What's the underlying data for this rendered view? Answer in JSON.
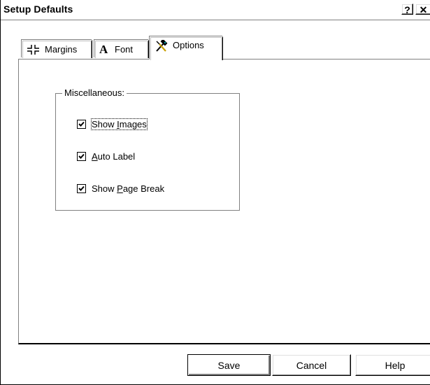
{
  "window": {
    "title": "Setup Defaults",
    "help_button": "?",
    "close_button": "✕"
  },
  "tabs": [
    {
      "label": "Margins",
      "icon": "margins-icon",
      "selected": false
    },
    {
      "label": "Font",
      "icon": "font-icon",
      "selected": false
    },
    {
      "label": "Options",
      "icon": "tools-icon",
      "selected": true
    }
  ],
  "miscellaneous": {
    "legend": "Miscellaneous:",
    "options": [
      {
        "pre": "Show ",
        "key": "I",
        "post": "mages",
        "checked": true
      },
      {
        "pre": "",
        "key": "A",
        "post": "uto Label",
        "checked": true
      },
      {
        "pre": "Show ",
        "key": "P",
        "post": "age Break",
        "checked": true
      }
    ]
  },
  "buttons": {
    "save": "Save",
    "cancel": "Cancel",
    "help": "Help"
  },
  "colors": {
    "background": "#ffffff",
    "shadow": "#808080",
    "border": "#000000"
  }
}
